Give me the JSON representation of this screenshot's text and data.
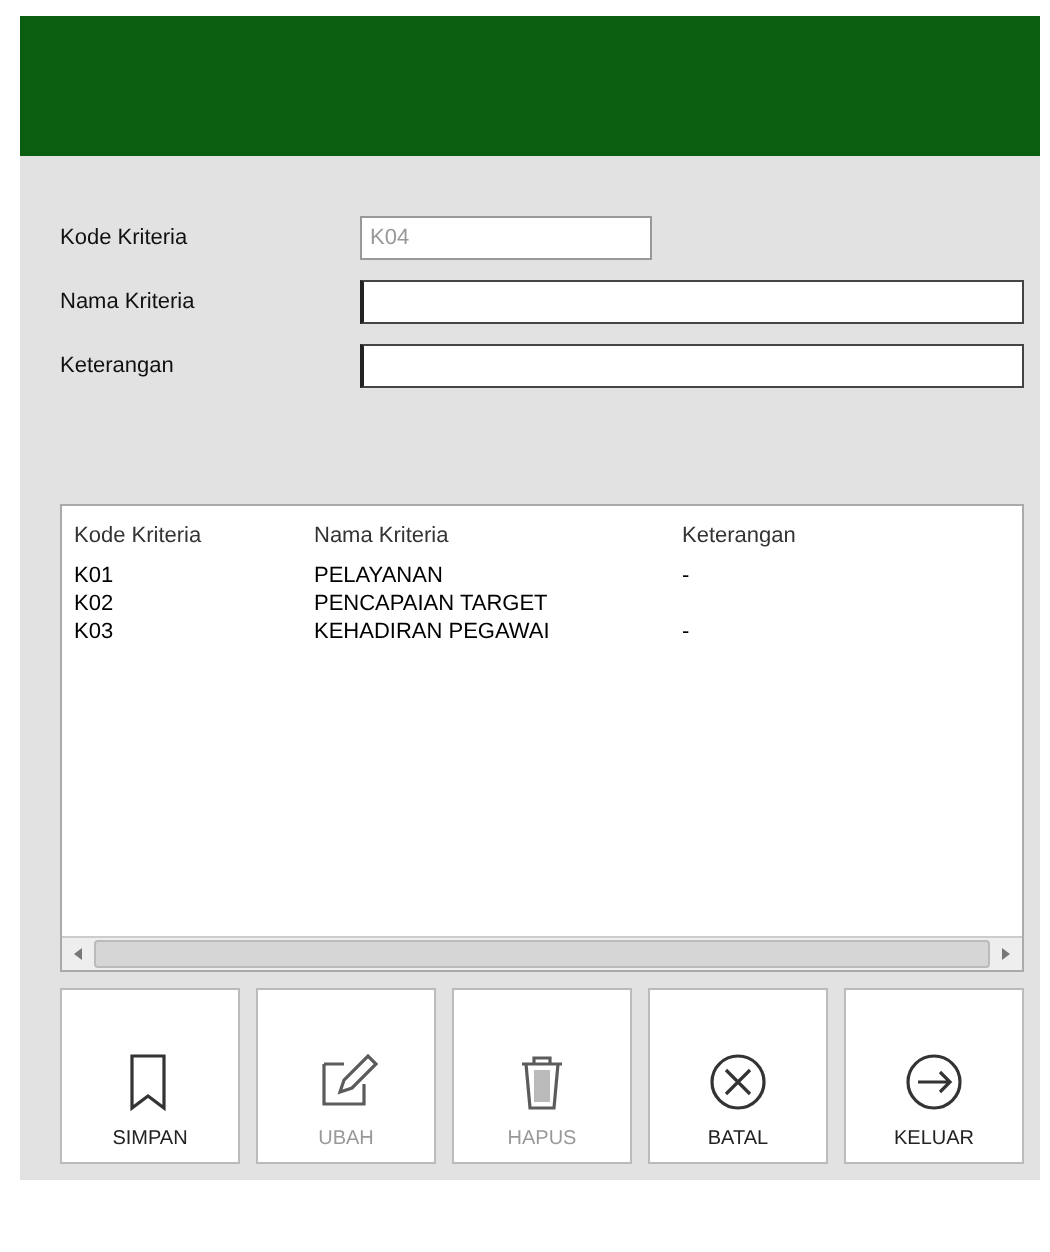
{
  "form": {
    "fields": [
      {
        "label": "Kode Kriteria",
        "value": "K04",
        "disabled": true,
        "kind": "short"
      },
      {
        "label": "Nama Kriteria",
        "disabled": false,
        "kind": "wide"
      },
      {
        "label": "Keterangan",
        "disabled": false,
        "kind": "wide"
      }
    ]
  },
  "table": {
    "columns": [
      "Kode Kriteria",
      "Nama Kriteria",
      "Keterangan"
    ],
    "rows": [
      [
        "K01",
        "PELAYANAN",
        "-"
      ],
      [
        "K02",
        "PENCAPAIAN TARGET"
      ],
      [
        "K03",
        "KEHADIRAN PEGAWAI",
        "-"
      ]
    ]
  },
  "buttons": [
    {
      "label": "SIMPAN",
      "kind": "bookmark",
      "disabled": false
    },
    {
      "label": "UBAH",
      "kind": "edit",
      "disabled": true
    },
    {
      "label": "HAPUS",
      "kind": "trash",
      "disabled": true
    },
    {
      "label": "BATAL",
      "kind": "cancel",
      "disabled": false
    },
    {
      "label": "KELUAR",
      "kind": "exit",
      "disabled": false
    }
  ]
}
